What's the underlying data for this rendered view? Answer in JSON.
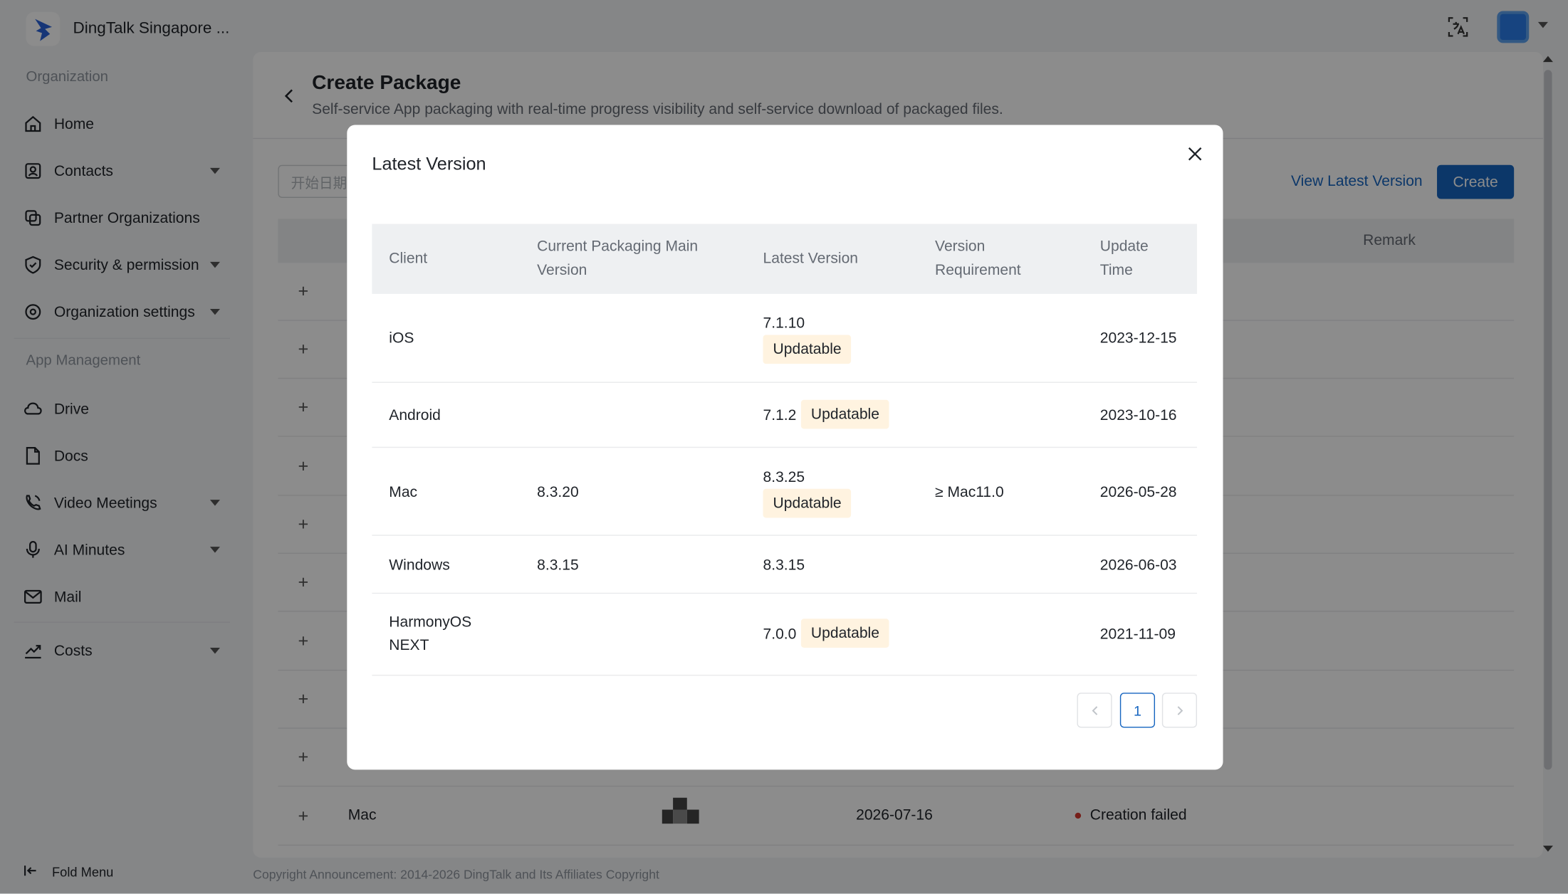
{
  "app": {
    "org_name": "DingTalk Singapore ..."
  },
  "sidebar": {
    "section_org": "Organization",
    "section_app": "App Management",
    "items": [
      {
        "label": "Home",
        "icon": "home-icon",
        "expandable": false
      },
      {
        "label": "Contacts",
        "icon": "contacts-icon",
        "expandable": true
      },
      {
        "label": "Partner Organizations",
        "icon": "partner-icon",
        "expandable": false
      },
      {
        "label": "Security & permission",
        "icon": "shield-icon",
        "expandable": true
      },
      {
        "label": "Organization settings",
        "icon": "settings-icon",
        "expandable": true
      },
      {
        "label": "Drive",
        "icon": "cloud-icon",
        "expandable": false
      },
      {
        "label": "Docs",
        "icon": "doc-icon",
        "expandable": false
      },
      {
        "label": "Video Meetings",
        "icon": "video-icon",
        "expandable": true
      },
      {
        "label": "AI Minutes",
        "icon": "mic-icon",
        "expandable": true
      },
      {
        "label": "Mail",
        "icon": "mail-icon",
        "expandable": false
      },
      {
        "label": "Costs",
        "icon": "chart-icon",
        "expandable": true
      }
    ],
    "fold_label": "Fold Menu"
  },
  "page": {
    "title": "Create Package",
    "description": "Self-service App packaging with real-time progress visibility and self-service download of packaged files.",
    "date_placeholder": "开始日期",
    "view_latest_label": "View Latest Version",
    "create_label": "Create",
    "remark_header": "Remark",
    "visible_row": {
      "client": "Mac",
      "date": "2026-07-16",
      "status": "Creation failed"
    }
  },
  "footer": {
    "copyright": "Copyright Announcement: 2014-2026 DingTalk and Its Affiliates Copyright"
  },
  "modal": {
    "title": "Latest Version",
    "columns": {
      "client": "Client",
      "current": "Current Packaging Main Version",
      "latest": "Latest Version",
      "requirement": "Version Requirement",
      "update_time": "Update Time"
    },
    "rows": [
      {
        "client": "iOS",
        "current": "",
        "latest": "7.1.10",
        "badge": "Updatable",
        "requirement": "",
        "update_time": "2023-12-15"
      },
      {
        "client": "Android",
        "current": "",
        "latest": "7.1.2",
        "badge": "Updatable",
        "requirement": "",
        "update_time": "2023-10-16"
      },
      {
        "client": "Mac",
        "current": "8.3.20",
        "latest": "8.3.25",
        "badge": "Updatable",
        "requirement": "≥ Mac11.0",
        "update_time": "2026-05-28"
      },
      {
        "client": "Windows",
        "current": "8.3.15",
        "latest": "8.3.15",
        "badge": "",
        "requirement": "",
        "update_time": "2026-06-03"
      },
      {
        "client": "HarmonyOS NEXT",
        "current": "",
        "latest": "7.0.0",
        "badge": "Updatable",
        "requirement": "",
        "update_time": "2021-11-09"
      }
    ],
    "pagination": {
      "current_page": "1"
    }
  },
  "colors": {
    "primary": "#1665c0",
    "badge_text": "#f08c00",
    "badge_bg": "#fff3e0",
    "failed_dot": "#d83931"
  }
}
